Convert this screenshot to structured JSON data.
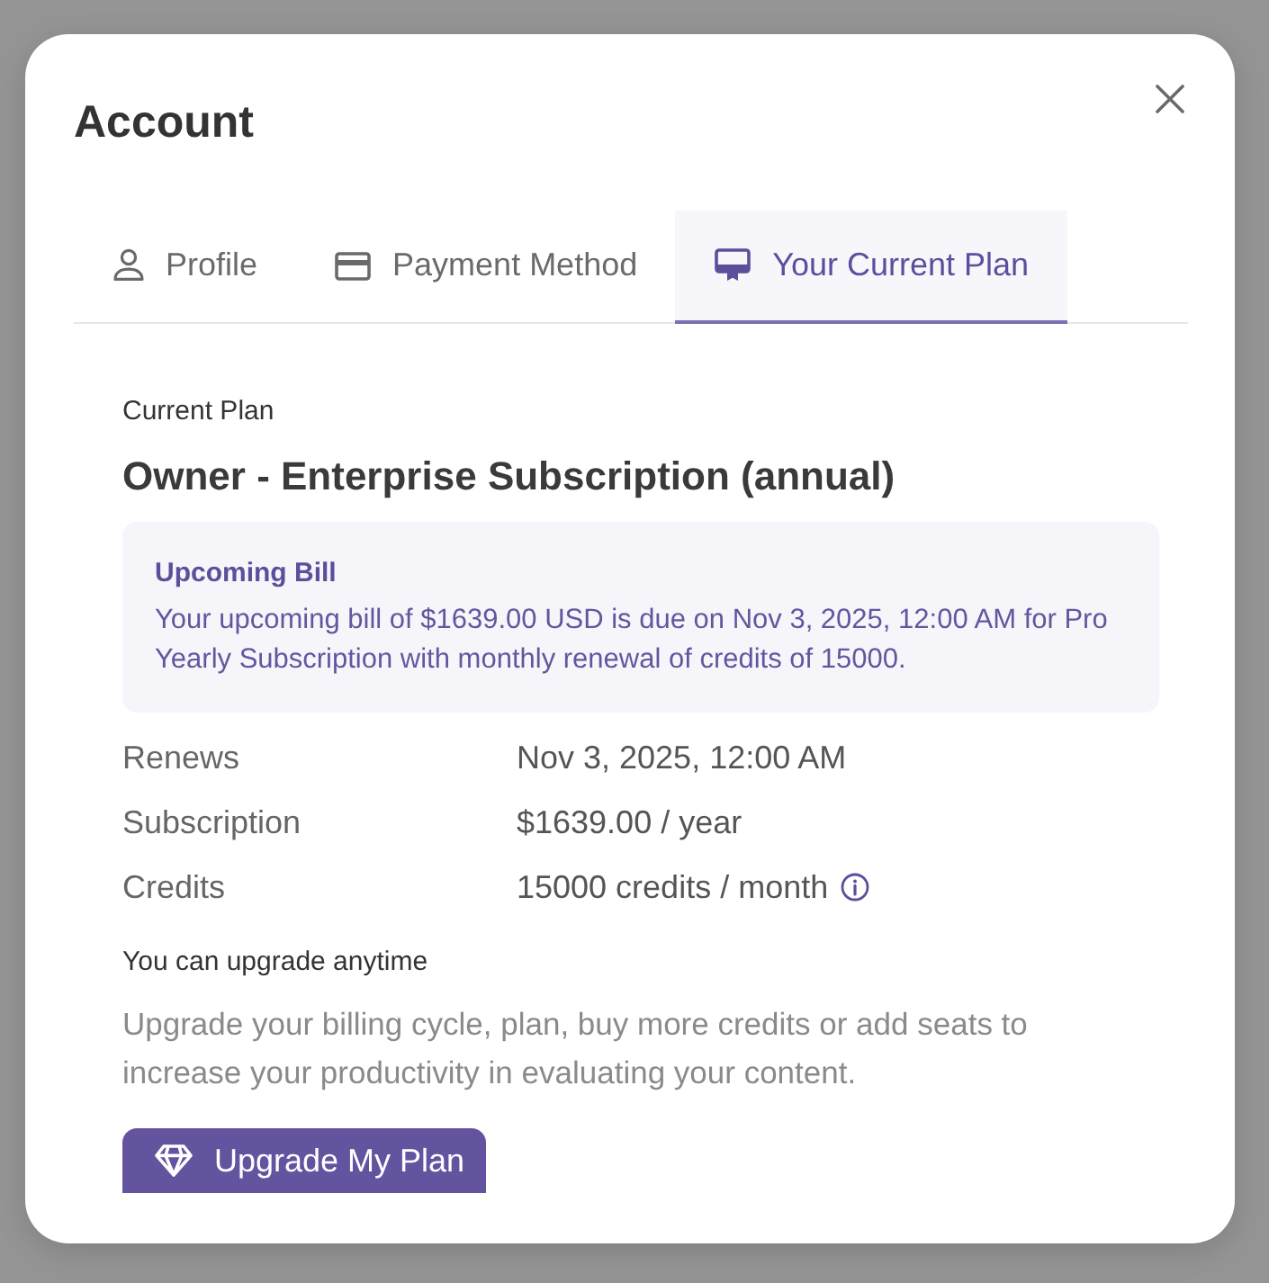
{
  "dialog": {
    "title": "Account"
  },
  "tabs": [
    {
      "label": "Profile",
      "selected": false
    },
    {
      "label": "Payment Method",
      "selected": false
    },
    {
      "label": "Your Current Plan",
      "selected": true
    }
  ],
  "plan": {
    "heading": "Current Plan",
    "name": "Owner - Enterprise Subscription (annual)"
  },
  "bill_notice": {
    "title": "Upcoming Bill",
    "text": "Your upcoming bill of $1639.00 USD is due on Nov 3, 2025, 12:00 AM for Pro Yearly Subscription with monthly renewal of credits of 15000."
  },
  "details": [
    {
      "label": "Renews",
      "value": "Nov 3, 2025, 12:00 AM",
      "info": false
    },
    {
      "label": "Subscription",
      "value": "$1639.00 / year",
      "info": false
    },
    {
      "label": "Credits",
      "value": "15000 credits / month",
      "info": true
    }
  ],
  "upgrade": {
    "heading": "You can upgrade anytime",
    "text": "Upgrade your billing cycle, plan, buy more credits or add seats to increase your productivity in evaluating your content.",
    "button": "Upgrade My Plan"
  }
}
